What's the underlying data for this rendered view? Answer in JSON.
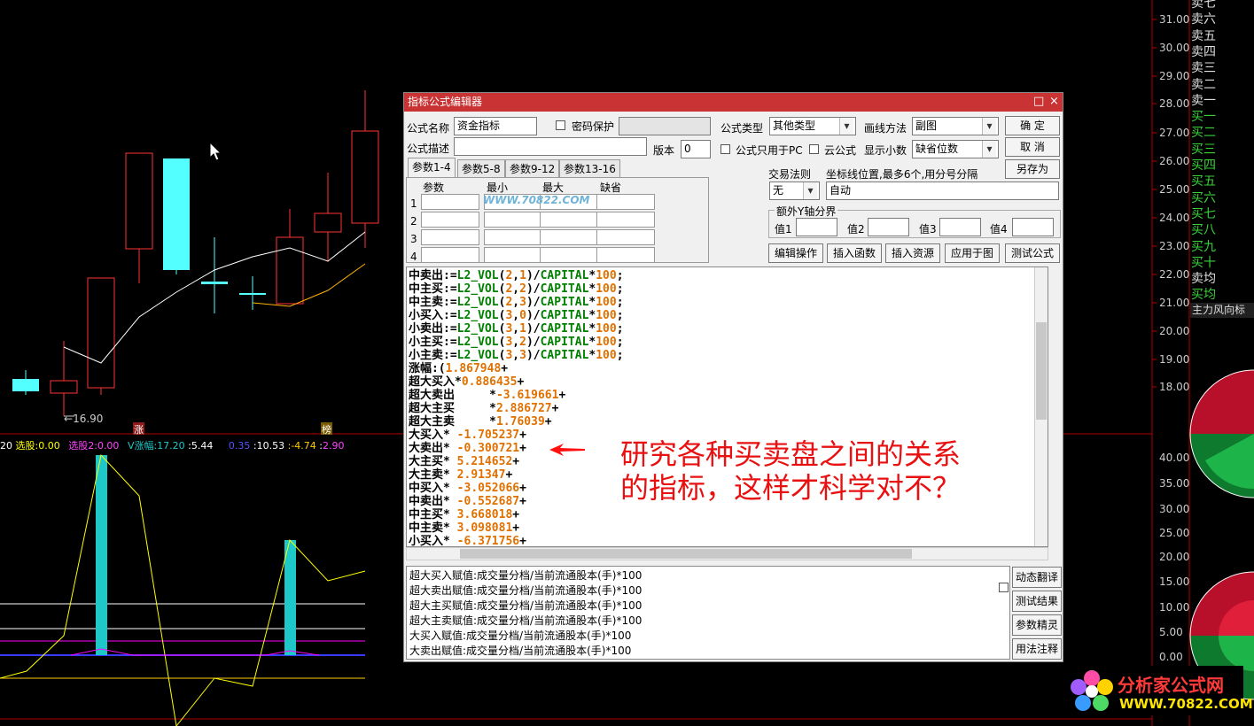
{
  "chart": {
    "price_ticks": [
      "31.00",
      "30.00",
      "29.00",
      "28.00",
      "27.00",
      "26.00",
      "25.00",
      "24.00",
      "23.00",
      "22.00",
      "21.00",
      "20.00",
      "19.00",
      "18.00"
    ],
    "indicator_ticks": [
      "40.00",
      "35.00",
      "30.00",
      "25.00",
      "20.00",
      "15.00",
      "10.00",
      "5.00",
      "0.00"
    ],
    "low_marker": "16.90",
    "badge_zhang": "涨",
    "badge_bang": "榜",
    "indicator_bar": {
      "p1": "20",
      "xuangu_label": "选股:",
      "xuangu_val": "0.00",
      "xuangu2_label": "选股2:",
      "xuangu2_val": "0.00",
      "vz_label": "V涨幅:",
      "vz_val": "17.20",
      "sep1": ":",
      "v2": "5.44",
      "v3": "0.35",
      "sep2": ":",
      "v4": "10.53",
      "v5": ":-4.74",
      "sep3": ":",
      "v6": "2.90"
    },
    "colors": {
      "up": "#ff3232",
      "down": "#54ffff",
      "ma1": "#ffffff",
      "ma2": "#ffb400",
      "yellow": "#ffff00",
      "magenta": "#ff00ff",
      "blue": "#3a3aff"
    }
  },
  "right_panel": {
    "items": [
      "卖七",
      "卖六",
      "卖五",
      "卖四",
      "卖三",
      "卖二",
      "卖一",
      "买一",
      "买二",
      "买三",
      "买四",
      "买五",
      "买六",
      "买七",
      "买八",
      "买九",
      "买十",
      "卖均",
      "买均"
    ],
    "tab": "主力风向标"
  },
  "dialog": {
    "title": "指标公式编辑器",
    "minimize": "□",
    "close": "×",
    "name_label": "公式名称",
    "name_value": "资金指标",
    "pwd_label": "密码保护",
    "type_label": "公式类型",
    "type_value": "其他类型",
    "draw_label": "画线方法",
    "draw_value": "副图",
    "ok": "确  定",
    "cancel": "取  消",
    "saveas": "另存为",
    "desc_label": "公式描述",
    "ver_label": "版本",
    "ver_value": "0",
    "pc_only": "公式只用于PC",
    "cloud": "云公式",
    "decimals_label": "显示小数",
    "decimals_value": "缺省位数",
    "tabs": [
      "参数1-4",
      "参数5-8",
      "参数9-12",
      "参数13-16"
    ],
    "param_headers": [
      "参数",
      "最小",
      "最大",
      "缺省"
    ],
    "param_rows": [
      "1",
      "2",
      "3",
      "4"
    ],
    "trade_label": "交易法则",
    "trade_value": "无",
    "axis_label": "坐标线位置,最多6个,用分号分隔",
    "axis_value": "自动",
    "extra_label": "额外Y轴分界",
    "vals": [
      "值1",
      "值2",
      "值3",
      "值4"
    ],
    "actions": [
      "编辑操作",
      "插入函数",
      "插入资源",
      "应用于图",
      "测试公式"
    ],
    "side_buttons": [
      "动态翻译",
      "测试结果",
      "参数精灵",
      "用法注释"
    ],
    "watermark": "WWW.70822.COM"
  },
  "code_lines": [
    {
      "k": "中卖出",
      "op": ":=",
      "f": "L2_VOL",
      "a": "2",
      "b": "1",
      "tail": ")/",
      "c": "CAPITAL",
      "m": "*",
      "n": "100",
      ";": ";"
    },
    {
      "k": "中主买",
      "op": ":=",
      "f": "L2_VOL",
      "a": "2",
      "b": "2",
      "tail": ")/",
      "c": "CAPITAL",
      "m": "*",
      "n": "100",
      ";": ";"
    },
    {
      "k": "中主卖",
      "op": ":=",
      "f": "L2_VOL",
      "a": "2",
      "b": "3",
      "tail": ")/",
      "c": "CAPITAL",
      "m": "*",
      "n": "100",
      ";": ";"
    },
    {
      "k": "小买入",
      "op": ":=",
      "f": "L2_VOL",
      "a": "3",
      "b": "0",
      "tail": ")/",
      "c": "CAPITAL",
      "m": "*",
      "n": "100",
      ";": ";"
    },
    {
      "k": "小卖出",
      "op": ":=",
      "f": "L2_VOL",
      "a": "3",
      "b": "1",
      "tail": ")/",
      "c": "CAPITAL",
      "m": "*",
      "n": "100",
      ";": ";"
    },
    {
      "k": "小主买",
      "op": ":=",
      "f": "L2_VOL",
      "a": "3",
      "b": "2",
      "tail": ")/",
      "c": "CAPITAL",
      "m": "*",
      "n": "100",
      ";": ";"
    },
    {
      "k": "小主卖",
      "op": ":=",
      "f": "L2_VOL",
      "a": "3",
      "b": "3",
      "tail": ")/",
      "c": "CAPITAL",
      "m": "*",
      "n": "100",
      ";": ";"
    }
  ],
  "coef_lines": [
    {
      "k": "涨幅",
      "p": ":(",
      "n": "1.867948",
      "s": "+"
    },
    {
      "k": "超大买入",
      "p": "*",
      "n": "0.886435",
      "s": "+"
    },
    {
      "k": "超大卖出",
      "p": "     *",
      "n": "-3.619661",
      "s": "+"
    },
    {
      "k": "超大主买",
      "p": "     *",
      "n": "2.886727",
      "s": "+"
    },
    {
      "k": "超大主卖",
      "p": "     *",
      "n": "1.76039",
      "s": "+"
    },
    {
      "k": "大买入",
      "p": "* ",
      "n": "-1.705237",
      "s": "+"
    },
    {
      "k": "大卖出",
      "p": "* ",
      "n": "-0.300721",
      "s": "+"
    },
    {
      "k": "大主买",
      "p": "* ",
      "n": "5.214652",
      "s": "+"
    },
    {
      "k": "大主卖",
      "p": "* ",
      "n": "2.91347",
      "s": "+"
    },
    {
      "k": "中买入",
      "p": "* ",
      "n": "-3.052066",
      "s": "+"
    },
    {
      "k": "中卖出",
      "p": "* ",
      "n": "-0.552687",
      "s": "+"
    },
    {
      "k": "中主买",
      "p": "* ",
      "n": "3.668018",
      "s": "+"
    },
    {
      "k": "中主卖",
      "p": "* ",
      "n": "3.098081",
      "s": "+"
    },
    {
      "k": "小买入",
      "p": "* ",
      "n": "-6.371756",
      "s": "+"
    }
  ],
  "hints": [
    "超大买入赋值:成交量分档/当前流通股本(手)*100",
    "超大卖出赋值:成交量分档/当前流通股本(手)*100",
    "超大主买赋值:成交量分档/当前流通股本(手)*100",
    "超大主卖赋值:成交量分档/当前流通股本(手)*100",
    "大买入赋值:成交量分档/当前流通股本(手)*100",
    "大卖出赋值:成交量分档/当前流通股本(手)*100"
  ],
  "annotation": {
    "line1": "研究各种买卖盘之间的关系",
    "line2": "的指标，这样才科学对不？"
  },
  "logo": {
    "line1": "分析家公式网",
    "line2": "WWW.70822.COM"
  }
}
